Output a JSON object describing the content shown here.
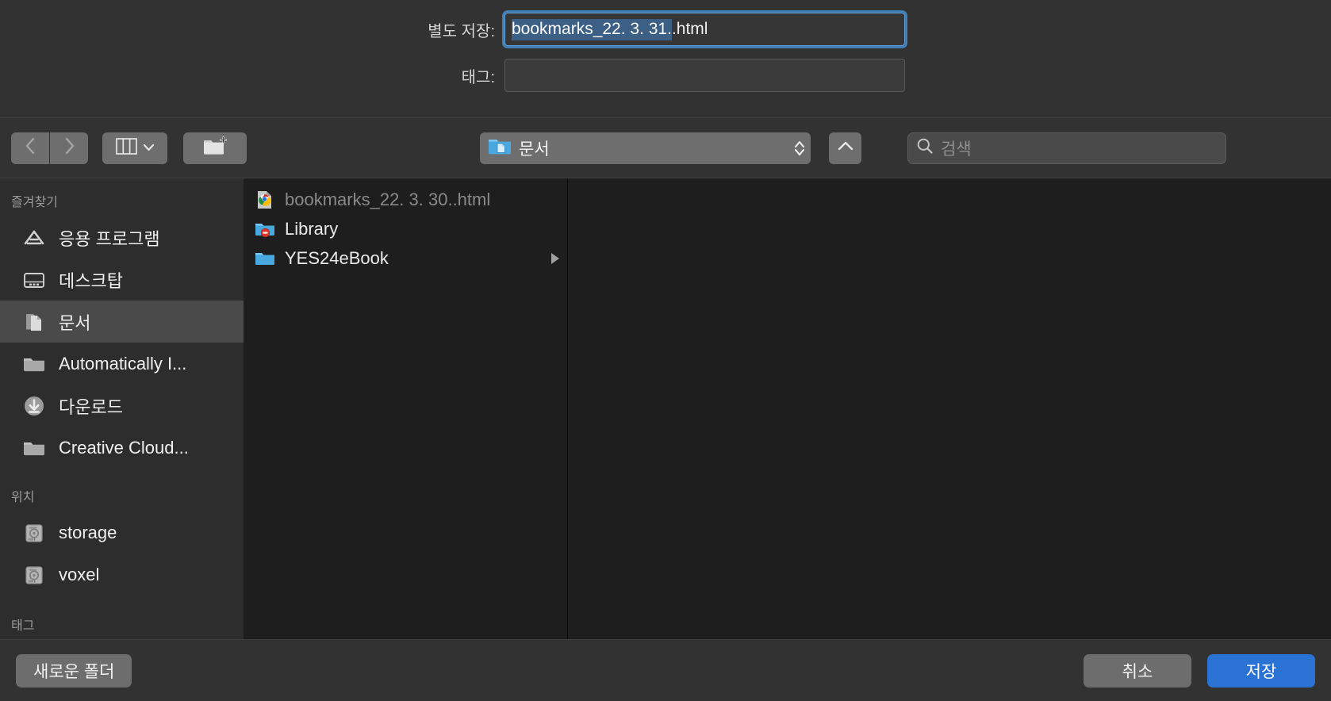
{
  "header": {
    "save_as_label": "별도 저장:",
    "filename_selected": "bookmarks_22. 3. 31.",
    "filename_extension": ".html",
    "tags_label": "태그:",
    "tags_value": ""
  },
  "toolbar": {
    "back_icon": "chevron-left-icon",
    "forward_icon": "chevron-right-icon",
    "view_mode": "column-view-icon",
    "view_chevron": "chevron-down-icon",
    "new_folder_icon": "new-folder-icon",
    "path_label": "문서",
    "path_folder_icon": "documents-folder-icon",
    "stepper_icon": "up-down-stepper-icon",
    "up_icon": "chevron-up-icon",
    "search_placeholder": "검색",
    "search_icon": "search-icon"
  },
  "sidebar": {
    "sections": [
      {
        "title": "즐겨찾기",
        "items": [
          {
            "label": "응용 프로그램",
            "icon": "applications-icon",
            "selected": false
          },
          {
            "label": "데스크탑",
            "icon": "desktop-icon",
            "selected": false
          },
          {
            "label": "문서",
            "icon": "documents-icon",
            "selected": true
          },
          {
            "label": "Automatically I...",
            "icon": "folder-icon",
            "selected": false
          },
          {
            "label": "다운로드",
            "icon": "downloads-icon",
            "selected": false
          },
          {
            "label": "Creative Cloud...",
            "icon": "folder-icon",
            "selected": false
          }
        ]
      },
      {
        "title": "위치",
        "items": [
          {
            "label": "storage",
            "icon": "hard-drive-icon",
            "selected": false
          },
          {
            "label": "voxel",
            "icon": "hard-drive-icon",
            "selected": false
          }
        ]
      },
      {
        "title": "태그",
        "items": []
      }
    ]
  },
  "file_list": {
    "rows": [
      {
        "name": "bookmarks_22. 3. 30..html",
        "icon": "chrome-html-document-icon",
        "dimmed": true,
        "has_children": false
      },
      {
        "name": "Library",
        "icon": "folder-restricted-icon",
        "dimmed": false,
        "has_children": false
      },
      {
        "name": "YES24eBook",
        "icon": "folder-icon",
        "dimmed": false,
        "has_children": true
      }
    ]
  },
  "footer": {
    "new_folder_label": "새로운 폴더",
    "cancel_label": "취소",
    "save_label": "저장"
  },
  "colors": {
    "accent_blue": "#2a72d4",
    "focus_ring": "#468ccd",
    "selection_blue": "#3c5f85",
    "window_bg": "#323232",
    "sidebar_bg": "#2d2d2d",
    "list_bg": "#1e1e1e",
    "folder_blue": "#53b4e8",
    "badge_red": "#e0352b"
  }
}
